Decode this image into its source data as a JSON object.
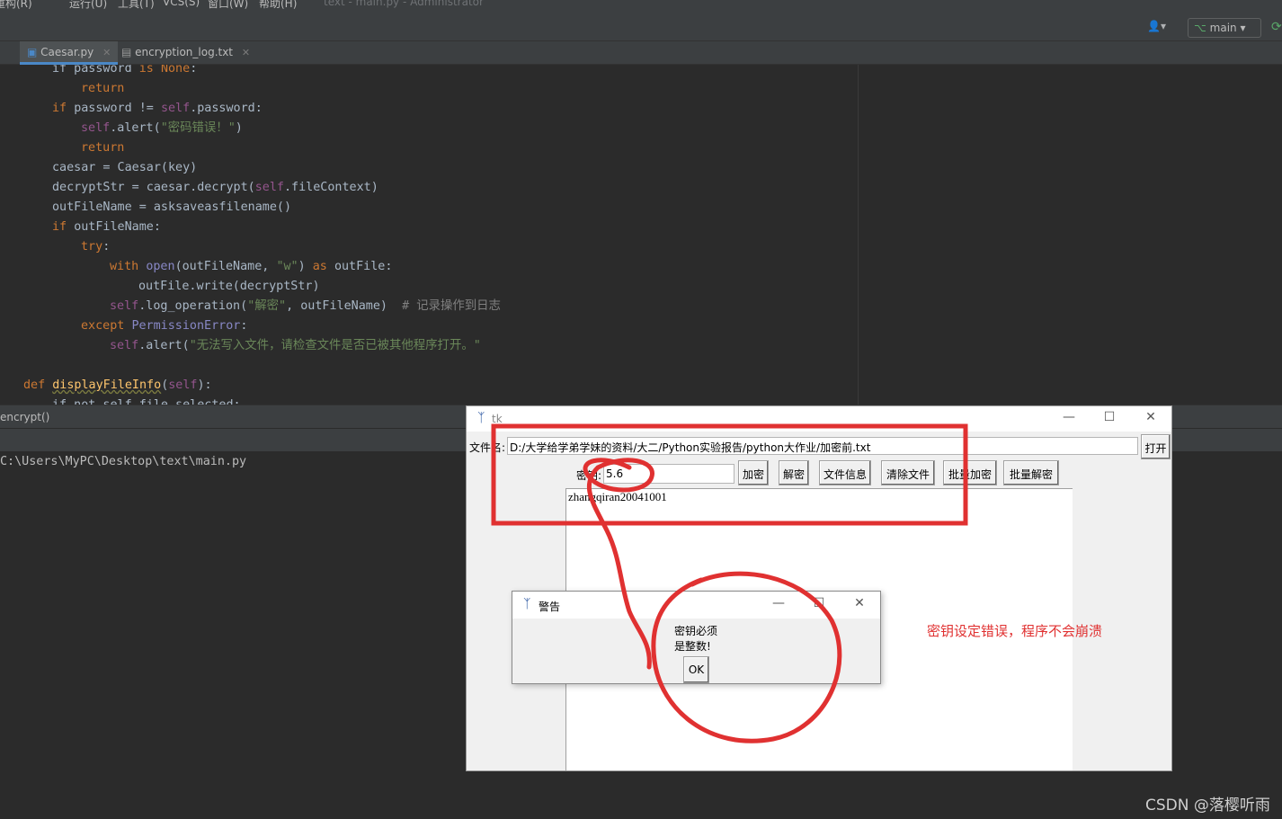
{
  "ide": {
    "menu": [
      "重构(R)",
      "运行(U)",
      "工具(T)",
      "VCS(S)",
      "窗口(W)",
      "帮助(H)"
    ],
    "window_title": "text - main.py - Administrator",
    "branch": "main",
    "tabs": [
      {
        "label": "Caesar.py"
      },
      {
        "label": "encryption_log.txt"
      }
    ],
    "code": [
      {
        "indent": 2,
        "parts": [
          [
            "if password ",
            ""
          ],
          [
            "is ",
            "k"
          ],
          [
            "None",
            "k"
          ],
          [
            ":",
            ""
          ]
        ]
      },
      {
        "indent": 3,
        "parts": [
          [
            "return",
            "k"
          ]
        ]
      },
      {
        "indent": 2,
        "parts": [
          [
            "if ",
            "k"
          ],
          [
            "password != ",
            ""
          ],
          [
            "self",
            "sf"
          ],
          [
            ".password:",
            ""
          ]
        ]
      },
      {
        "indent": 3,
        "parts": [
          [
            "self",
            "sf"
          ],
          [
            ".alert(",
            ""
          ],
          [
            "\"密码错误！\"",
            "s"
          ],
          [
            ")",
            ""
          ]
        ]
      },
      {
        "indent": 3,
        "parts": [
          [
            "return",
            "k"
          ]
        ]
      },
      {
        "indent": 2,
        "parts": [
          [
            "caesar = Caesar(key)",
            ""
          ]
        ]
      },
      {
        "indent": 2,
        "parts": [
          [
            "decryptStr = caesar.decrypt(",
            ""
          ],
          [
            "self",
            "sf"
          ],
          [
            ".fileContext)",
            ""
          ]
        ]
      },
      {
        "indent": 2,
        "parts": [
          [
            "outFileName = asksaveasfilename()",
            ""
          ]
        ]
      },
      {
        "indent": 2,
        "parts": [
          [
            "if ",
            "k"
          ],
          [
            "outFileName:",
            ""
          ]
        ]
      },
      {
        "indent": 3,
        "parts": [
          [
            "try",
            "k"
          ],
          [
            ":",
            ""
          ]
        ]
      },
      {
        "indent": 4,
        "parts": [
          [
            "with ",
            "k"
          ],
          [
            "open",
            "bi"
          ],
          [
            "(outFileName, ",
            ""
          ],
          [
            "\"w\"",
            "s"
          ],
          [
            ") ",
            ""
          ],
          [
            "as ",
            "k"
          ],
          [
            "outFile:",
            ""
          ]
        ]
      },
      {
        "indent": 5,
        "parts": [
          [
            "outFile.write(decryptStr)",
            ""
          ]
        ]
      },
      {
        "indent": 4,
        "parts": [
          [
            "self",
            "sf"
          ],
          [
            ".log_operation(",
            ""
          ],
          [
            "\"解密\"",
            "s"
          ],
          [
            ", outFileName)  ",
            ""
          ],
          [
            "# 记录操作到日志",
            "cm"
          ]
        ]
      },
      {
        "indent": 3,
        "parts": [
          [
            "except ",
            "k"
          ],
          [
            "PermissionError",
            "bi"
          ],
          [
            ":",
            ""
          ]
        ]
      },
      {
        "indent": 4,
        "parts": [
          [
            "self",
            "sf"
          ],
          [
            ".alert(",
            ""
          ],
          [
            "\"无法写入文件，请检查文件是否已被其他程序打开。\"",
            "s"
          ]
        ]
      },
      {
        "indent": 0,
        "parts": []
      },
      {
        "indent": 1,
        "parts": [
          [
            "def ",
            "k"
          ],
          [
            "displayFileInfo",
            "f wav"
          ],
          [
            "(",
            ""
          ],
          [
            "self",
            "sf"
          ],
          [
            "):",
            ""
          ]
        ]
      },
      {
        "indent": 2,
        "parts": [
          [
            "if not self file selected:",
            ""
          ]
        ]
      }
    ],
    "run_tab": "encrypt()",
    "run_path": "C:\\Users\\MyPC\\Desktop\\text\\main.py"
  },
  "tk": {
    "title": "tk",
    "file_label": "文件名:",
    "file_path": "D:/大学给学弟学妹的资料/大二/Python实验报告/python大作业/加密前.txt",
    "open_button": "打开",
    "key_label": "密钥:",
    "key_value": "5.6",
    "buttons": [
      "加密",
      "解密",
      "文件信息",
      "清除文件",
      "批量加密",
      "批量解密"
    ],
    "content": "zhangqiran20041001"
  },
  "dialog": {
    "title": "警告",
    "message": "密钥必须\n是整数!",
    "ok": "OK"
  },
  "annotation": {
    "note": "密钥设定错误，程序不会崩溃",
    "color": "#e03131"
  },
  "watermark": "CSDN @落樱听雨"
}
